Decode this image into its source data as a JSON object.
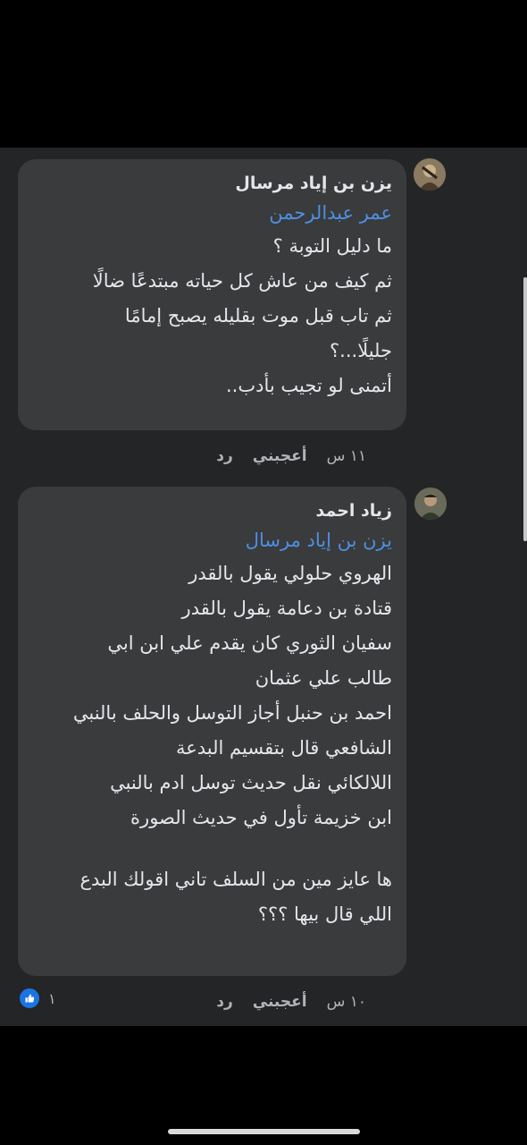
{
  "comments": [
    {
      "author": "يزن بن إياد مرسال",
      "mention": "عمر عبدالرحمن",
      "lines": [
        "ما دليل التوبة ؟",
        "ثم كيف من عاش كل حياته مبتدعًا ضالًا",
        "ثم تاب قبل موت بقليله يصبح إمامًا",
        "جليلًا...؟",
        "أتمنى لو تجيب بأدب.."
      ],
      "time": "١١ س",
      "like_label": "أعجبني",
      "reply_label": "رد"
    },
    {
      "author": "زياد احمد",
      "mention": "يزن بن إياد مرسال",
      "lines": [
        "الهروي حلولي يقول بالقدر",
        "قتادة بن دعامة يقول بالقدر",
        "سفيان الثوري كان يقدم علي ابن ابي",
        "طالب علي عثمان",
        "احمد بن حنبل أجاز التوسل والحلف بالنبي",
        "الشافعي قال بتقسيم البدعة",
        "اللالكائي نقل حديث توسل ادم بالنبي",
        "ابن خزيمة تأول في حديث الصورة"
      ],
      "lines_after_gap": [
        "ها عايز مين من السلف تاني اقولك البدع",
        "اللي قال بيها ؟؟؟"
      ],
      "time": "١٠ س",
      "like_label": "أعجبني",
      "reply_label": "رد",
      "reaction_count": "١"
    }
  ],
  "colors": {
    "background": "#000000",
    "panel": "#242526",
    "bubble": "#3a3b3c",
    "mention": "#4e8fe3",
    "meta": "#b0b3b8",
    "like_badge": "#1b74e4"
  },
  "icons": [
    "avatar-1",
    "avatar-2",
    "like-reaction-icon"
  ]
}
